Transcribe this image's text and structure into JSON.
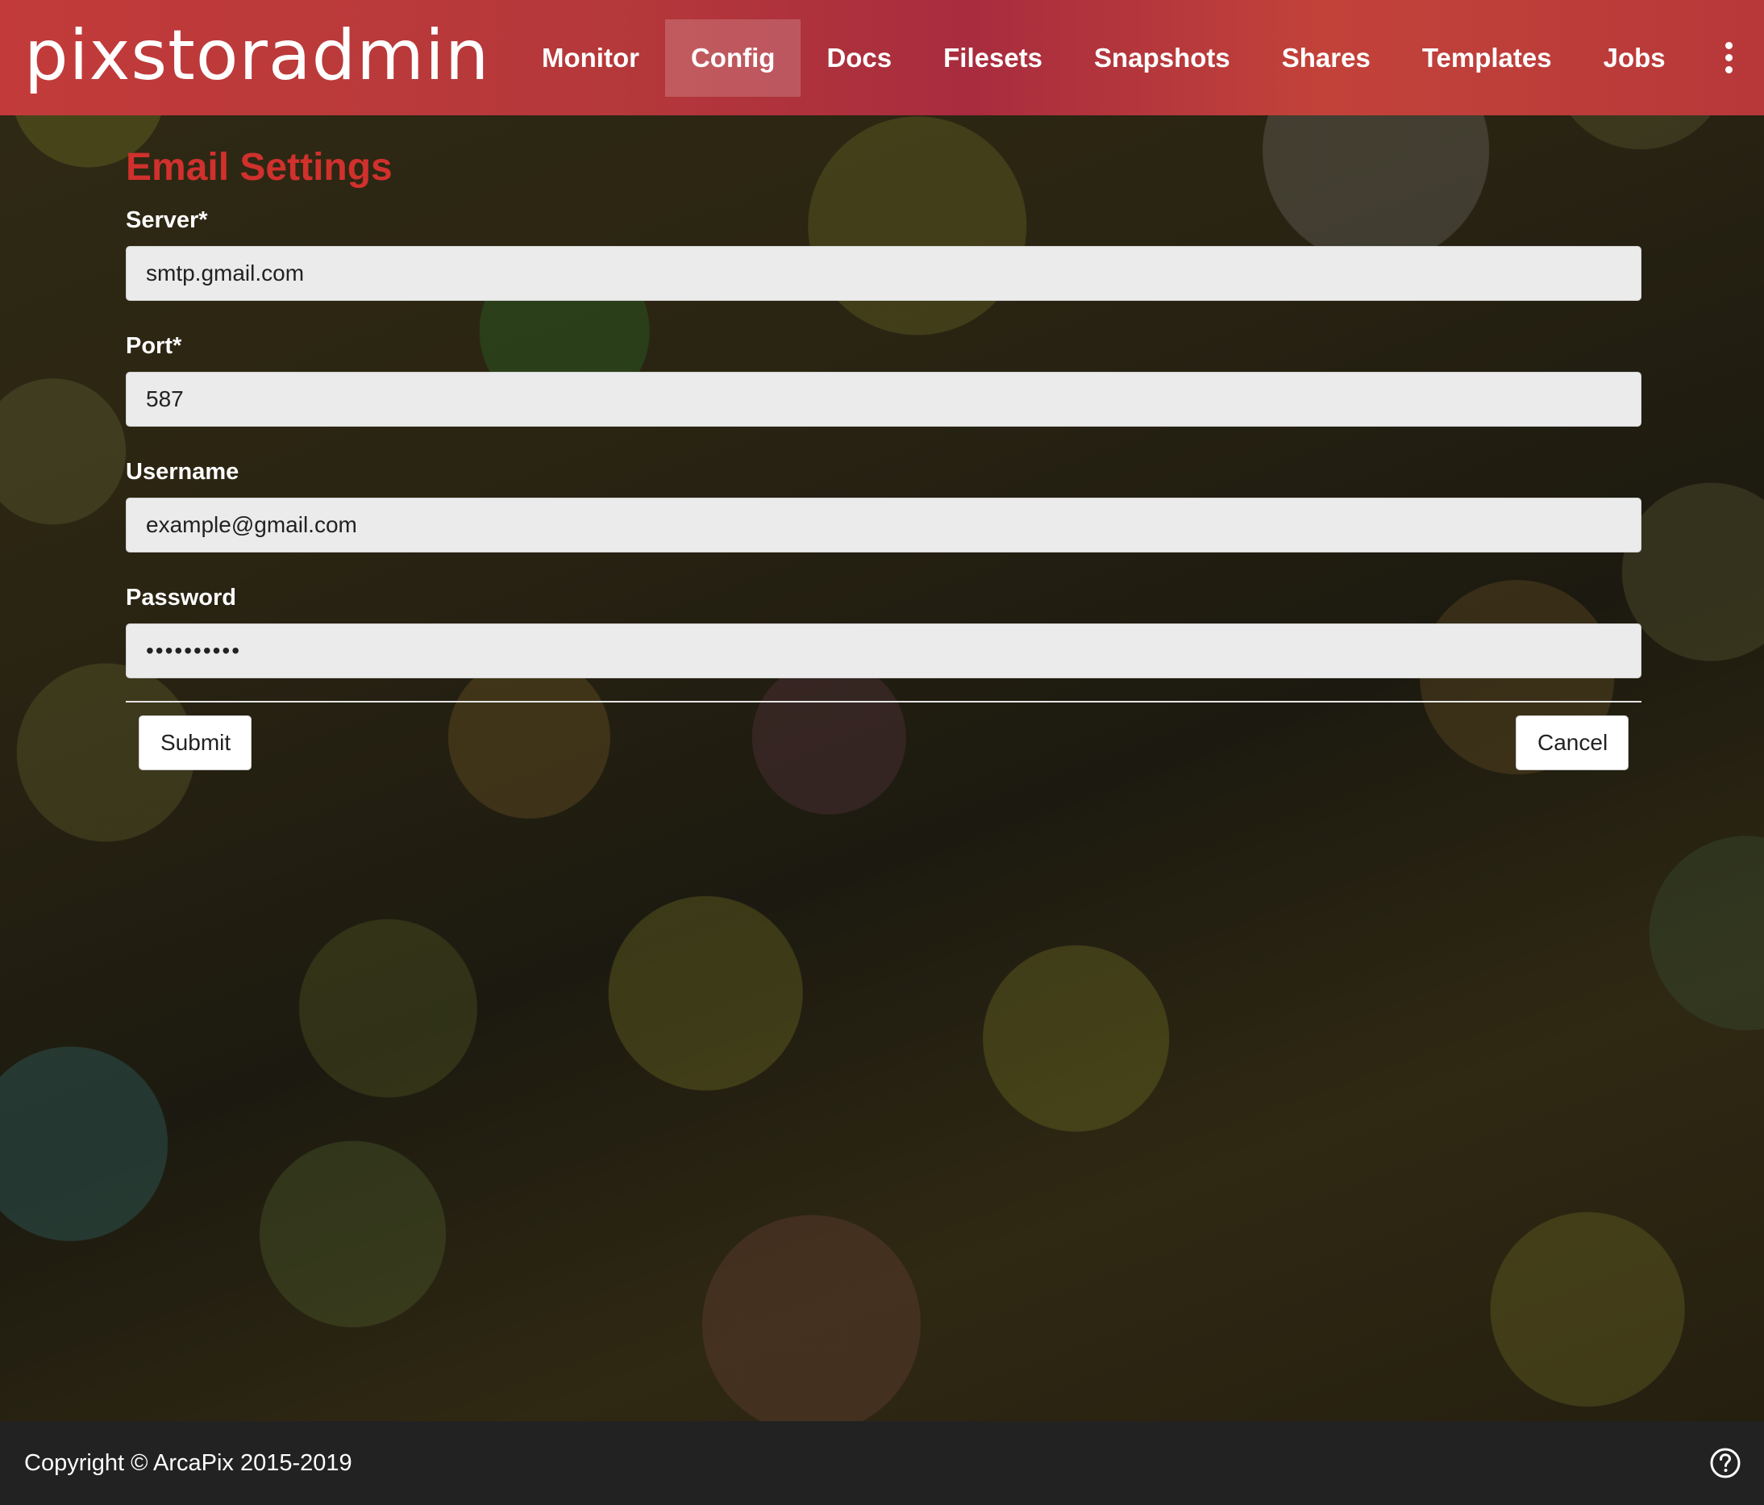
{
  "app": {
    "brand": "pixstoradmin"
  },
  "nav": {
    "items": [
      {
        "label": "Monitor"
      },
      {
        "label": "Config"
      },
      {
        "label": "Docs"
      },
      {
        "label": "Filesets"
      },
      {
        "label": "Snapshots"
      },
      {
        "label": "Shares"
      },
      {
        "label": "Templates"
      },
      {
        "label": "Jobs"
      }
    ],
    "active": "Config",
    "more_icon": "kebab-menu-icon"
  },
  "form": {
    "title": "Email Settings",
    "server": {
      "label": "Server*",
      "value": "smtp.gmail.com"
    },
    "port": {
      "label": "Port*",
      "value": "587"
    },
    "username": {
      "label": "Username",
      "value": "example@gmail.com"
    },
    "password": {
      "label": "Password",
      "value": "••••••••••"
    },
    "submit_label": "Submit",
    "cancel_label": "Cancel"
  },
  "footer": {
    "copyright": "Copyright © ArcaPix 2015-2019",
    "help_icon": "help-circle-icon"
  },
  "colors": {
    "header": "#b5383a",
    "title": "#d0312d",
    "footer": "#222222",
    "input_bg": "#ebebeb"
  }
}
